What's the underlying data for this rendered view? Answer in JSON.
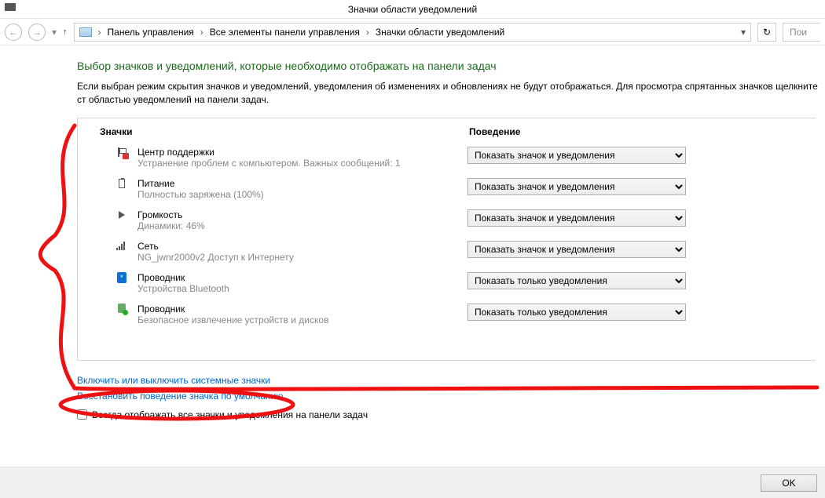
{
  "window_title": "Значки области уведомлений",
  "breadcrumb": {
    "p1": "Панель управления",
    "p2": "Все элементы панели управления",
    "p3": "Значки области уведомлений"
  },
  "search_placeholder": "Пои",
  "heading": "Выбор значков и уведомлений, которые необходимо отображать на панели задач",
  "description": "Если выбран режим скрытия значков и уведомлений, уведомления об изменениях и обновлениях не будут отображаться. Для просмотра спрятанных значков щелкните ст областью уведомлений на панели задач.",
  "col_icons": "Значки",
  "col_behavior": "Поведение",
  "items": [
    {
      "title": "Центр поддержки",
      "sub": "Устранение проблем с компьютером. Важных сообщений: 1",
      "value": "Показать значок и уведомления"
    },
    {
      "title": "Питание",
      "sub": "Полностью заряжена (100%)",
      "value": "Показать значок и уведомления"
    },
    {
      "title": "Громкость",
      "sub": "Динамики: 46%",
      "value": "Показать значок и уведомления"
    },
    {
      "title": "Сеть",
      "sub": "NG_jwnr2000v2 Доступ к Интернету",
      "value": "Показать значок и уведомления"
    },
    {
      "title": "Проводник",
      "sub": "Устройства Bluetooth",
      "value": "Показать только уведомления"
    },
    {
      "title": "Проводник",
      "sub": "Безопасное извлечение устройств и дисков",
      "value": "Показать только уведомления"
    }
  ],
  "link_system": "Включить или выключить системные значки",
  "link_restore": "Восстановить поведение значка по умолчанию",
  "checkbox_label": "Всегда отображать все значки и уведомления на панели задач",
  "ok": "OK"
}
